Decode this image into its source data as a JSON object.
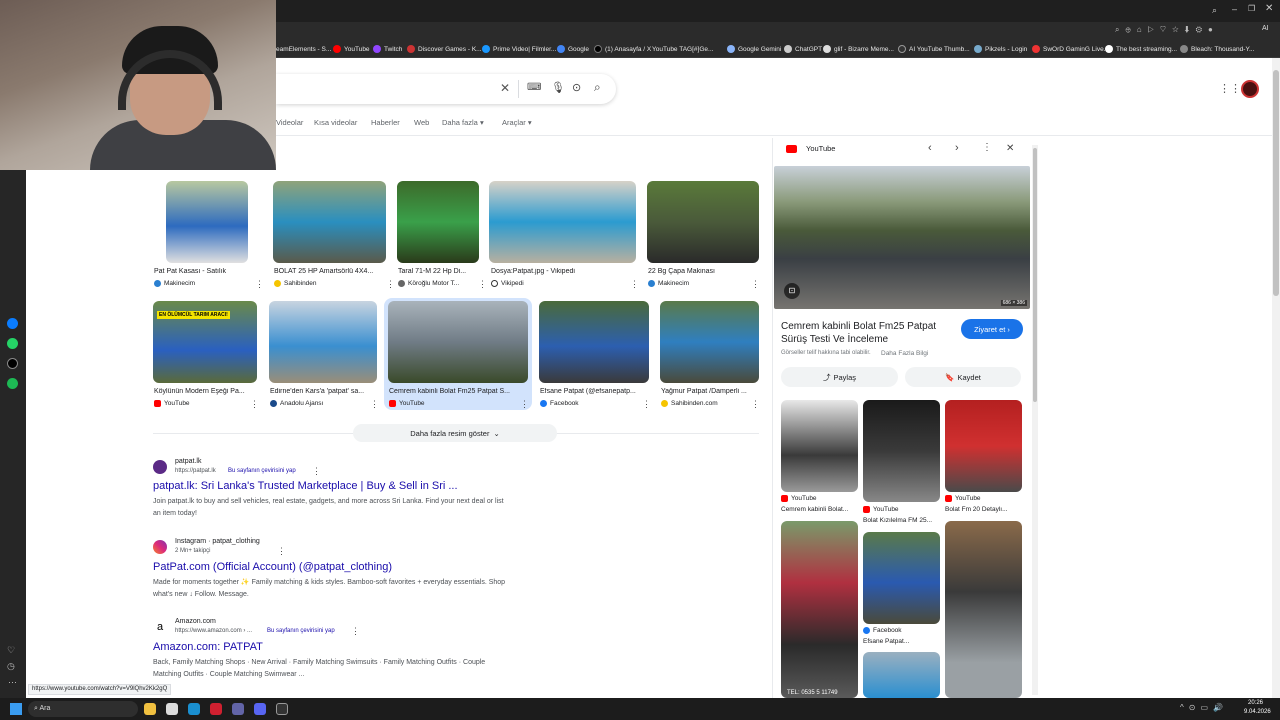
{
  "bookmarks": [
    "eamElements - S...",
    "YouTube",
    "Twitch",
    "Discover Games - K...",
    "Prime Video| Filmler...",
    "Google",
    "(1) Anasayfa / X",
    "YouTube TAG[#]Ge...",
    "Google Gemini",
    "ChatGPT",
    "glif - Bizarre Meme...",
    "AI YouTube Thumb...",
    "Pikzels - Login",
    "SwOrD GaminG Live...",
    "The best streaming...",
    "Bleach: Thousand-Y..."
  ],
  "tabs": [
    "Videolar",
    "Kısa videolar",
    "Haberler",
    "Web",
    "Daha fazla ▾",
    "Araçlar ▾"
  ],
  "images_row1": [
    {
      "caption": "Pat Pat Kasası - Satılık",
      "source": "Makinecim",
      "color": "#2d6bbf"
    },
    {
      "caption": "BOLAT 25 HP Amartsörlü 4X4...",
      "source": "Sahibinden",
      "color": "#2a8fbf"
    },
    {
      "caption": "Taral 71-M 22 Hp Di...",
      "source": "Köroğlu Motor T...",
      "color": "#3aa04a"
    },
    {
      "caption": "Dosya:Patpat.jpg - Vikipedi",
      "source": "Vikipedi",
      "color": "#2b9bd0"
    },
    {
      "caption": "22 Bg Çapa Makinası",
      "source": "Makinecim",
      "color": "#4a5a3a"
    }
  ],
  "images_row2": [
    {
      "caption": "Köylünün Modern Eşeği Pa...",
      "source": "YouTube",
      "color": "#2a60c0"
    },
    {
      "caption": "Edirne'den Kars'a 'patpat' sa...",
      "source": "Anadolu Ajansı",
      "color": "#3a8fd0"
    },
    {
      "caption": "Cemrem kabinli Bolat Fm25 Patpat S...",
      "source": "YouTube",
      "color": "#707c86"
    },
    {
      "caption": "Efsane Patpat (@efsanepatp...",
      "source": "Facebook",
      "color": "#2c5fb0"
    },
    {
      "caption": "Yağmur Patpat /Damperli ...",
      "source": "Sahibinden.com",
      "color": "#2f7fc0"
    }
  ],
  "overlay_badge": "EN ÖLÜMCÜL TARIM ARACI!",
  "more_images": "Daha fazla resim göster",
  "results": [
    {
      "site": "patpat.lk",
      "url": "https://patpat.lk",
      "translate": "Bu sayfanın çevirisini yap",
      "title": "patpat.lk: Sri Lanka's Trusted Marketplace | Buy & Sell in Sri ...",
      "snippet": "Join patpat.lk to buy and sell vehicles, real estate, gadgets, and more across Sri Lanka. Find your next deal or list an item today!"
    },
    {
      "site": "Instagram · patpat_clothing",
      "url": "2 Mn+ takipçi",
      "translate": "",
      "title": "PatPat.com (Official Account) (@patpat_clothing)",
      "snippet": "Made for moments together ✨ Family matching & kids styles. Bamboo-soft favorites + everyday essentials. Shop what's new ↓ Follow. Message."
    },
    {
      "site": "Amazon.com",
      "url": "https://www.amazon.com › ...",
      "translate": "Bu sayfanın çevirisini yap",
      "title": "Amazon.com: PATPAT",
      "snippet": "Back, Family Matching Shops · New Arrival · Family Matching Swimsuits · Family Matching Outfits · Couple Matching Outfits · Couple Matching Swimwear ..."
    }
  ],
  "panel": {
    "source": "YouTube",
    "size": "686 × 386",
    "title": "Cemrem kabinli Bolat Fm25 Patpat Sürüş Testi Ve İnceleme",
    "visit": "Ziyaret et ›",
    "copyright": "Görseller telif hakkına tabi olabilir.",
    "learn_more": "Daha Fazla Bilgi",
    "share": "Paylaş",
    "save": "Kaydet",
    "related": [
      {
        "source": "YouTube",
        "caption": "Cemrem kabinli Bolat..."
      },
      {
        "source": "YouTube",
        "caption": "Bolat Kızılelma FM 25..."
      },
      {
        "source": "YouTube",
        "caption": "Bolat Fm 20 Detaylı..."
      },
      {
        "source": "Facebook",
        "caption": "Efsane Patpat..."
      }
    ],
    "plate": "TEL: 0535 5 11749"
  },
  "status_url": "https://www.youtube.com/watch?v=V9lQhv2Kk2gQ",
  "taskbar": {
    "search": "Ara",
    "time": "20:26",
    "date": "9.04.2026"
  }
}
